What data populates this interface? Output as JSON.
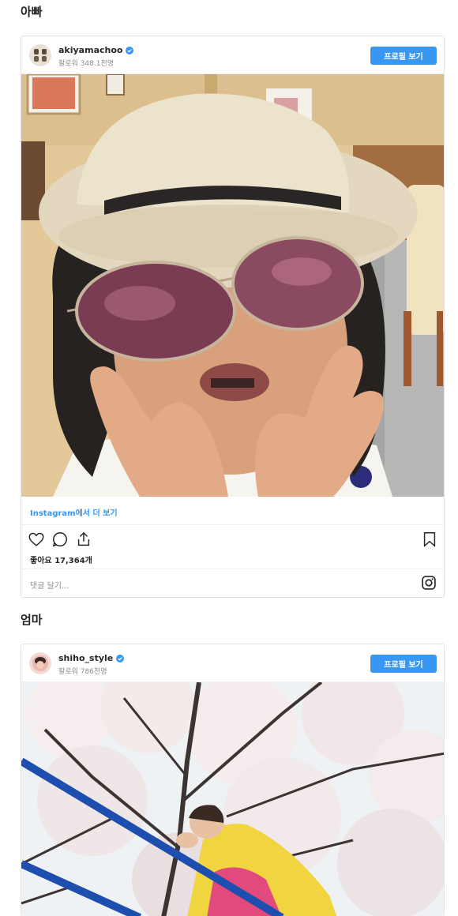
{
  "sections": [
    {
      "title": "아빠",
      "post": {
        "username": "akiyamachoo",
        "followers": "팔로워 348.1천명",
        "profile_button": "프로필 보기",
        "more_link": "Instagram에서 더 보기",
        "likes": "좋아요 17,364개",
        "comment_placeholder": "댓글 달기..."
      }
    },
    {
      "title": "엄마",
      "post": {
        "username": "shiho_style",
        "followers": "팔로워 786천명",
        "profile_button": "프로필 보기"
      }
    }
  ],
  "colors": {
    "accent": "#3897f0",
    "text": "#262626",
    "muted": "#8e8e8e",
    "border": "#e2e2e2"
  },
  "icons": [
    "verified-badge-icon",
    "heart-icon",
    "comment-icon",
    "share-icon",
    "bookmark-icon",
    "instagram-icon"
  ]
}
